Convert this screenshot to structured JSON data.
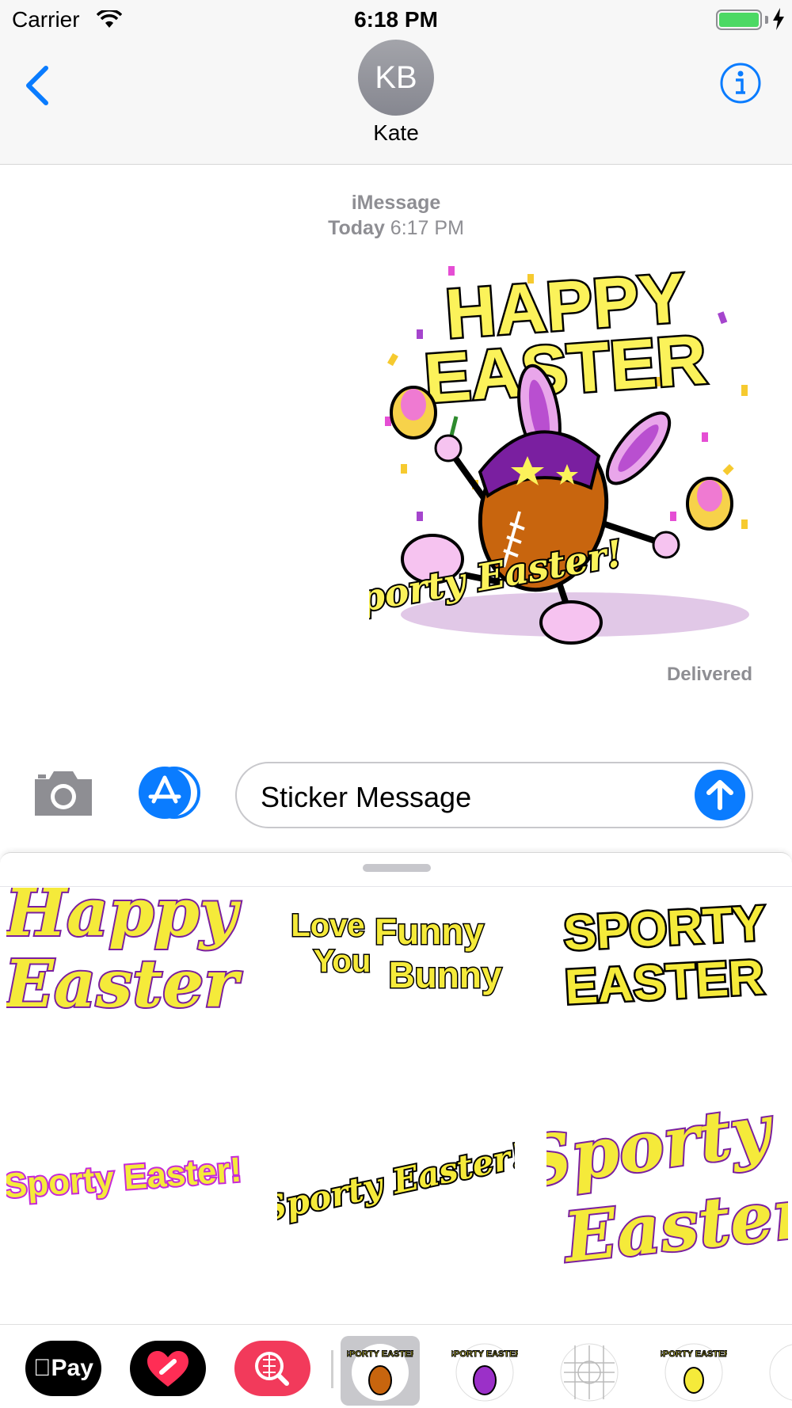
{
  "status_bar": {
    "carrier": "Carrier",
    "time": "6:18 PM",
    "battery_color": "#4cd964"
  },
  "header": {
    "avatar_initials": "KB",
    "contact_name": "Kate",
    "back_icon": "chevron-left-icon",
    "info_icon": "info-icon",
    "accent": "#0a7cff"
  },
  "conversation": {
    "service": "iMessage",
    "day": "Today",
    "time": "6:17 PM",
    "sticker": {
      "line1": "HAPPY",
      "line2": "EASTER",
      "script": "Sporty Easter!"
    },
    "status": "Delivered"
  },
  "input": {
    "placeholder": "Sticker Message",
    "camera_icon": "camera-icon",
    "appstore_icon": "app-store-icon",
    "send_icon": "arrow-up-icon"
  },
  "stickers": [
    {
      "lines": [
        "Happy",
        "Easter"
      ]
    },
    {
      "lines": [
        "Love",
        "You",
        "Funny",
        "Bunny"
      ]
    },
    {
      "lines": [
        "SPORTY",
        "EASTER"
      ]
    },
    {
      "lines": [
        "Sporty Easter!"
      ]
    },
    {
      "lines": [
        "Sporty Easter!"
      ]
    },
    {
      "lines": [
        "Sporty",
        "Easter"
      ]
    }
  ],
  "app_strip": {
    "apple_pay_label": "Pay",
    "apps": [
      "apple-pay-icon",
      "digital-touch-icon",
      "image-search-icon"
    ],
    "thumb_label": "SPORTY EASTER"
  }
}
